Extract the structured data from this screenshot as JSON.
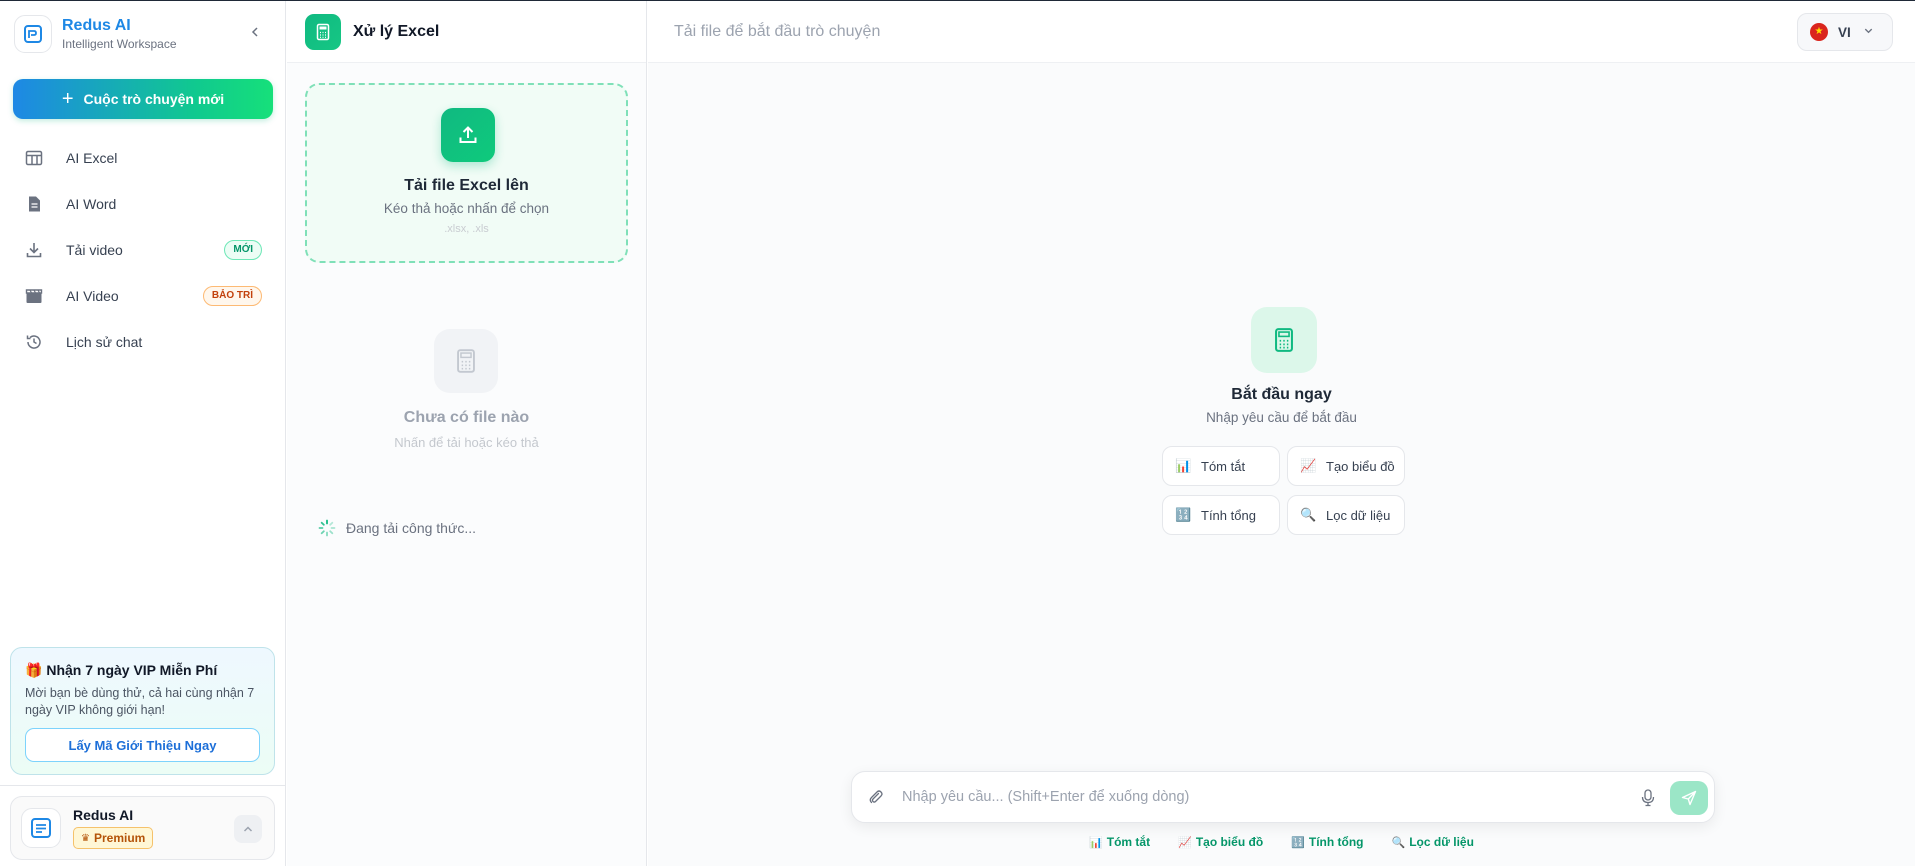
{
  "brand": {
    "name": "Redus AI",
    "subtitle": "Intelligent Workspace"
  },
  "sidebar": {
    "new_chat_label": "Cuộc trò chuyện mới",
    "items": [
      {
        "label": "AI Excel",
        "icon": "table-icon"
      },
      {
        "label": "AI Word",
        "icon": "document-icon"
      },
      {
        "label": "Tải video",
        "icon": "download-icon",
        "badge": "MỚI"
      },
      {
        "label": "AI Video",
        "icon": "clapperboard-icon",
        "badge": "BẢO TRÌ"
      },
      {
        "label": "Lịch sử chat",
        "icon": "history-icon"
      }
    ]
  },
  "vip": {
    "title": "Nhận 7 ngày VIP Miễn Phí",
    "description": "Mời bạn bè dùng thử, cả hai cùng nhận 7 ngày VIP không giới hạn!",
    "button": "Lấy Mã Giới Thiệu Ngay"
  },
  "user": {
    "name": "Redus AI",
    "plan": "Premium"
  },
  "file_panel": {
    "title": "Xử lý Excel",
    "dropzone": {
      "title": "Tải file Excel lên",
      "subtitle": "Kéo thả hoặc nhấn để chọn",
      "extensions": ".xlsx, .xls"
    },
    "empty": {
      "title": "Chưa có file nào",
      "subtitle": "Nhấn để tải hoặc kéo thả"
    },
    "loading": "Đang tải công thức..."
  },
  "main": {
    "title": "Tải file để bắt đầu trò chuyện",
    "language": "VI",
    "welcome": {
      "title": "Bắt đầu ngay",
      "subtitle": "Nhập yêu cầu để bắt đầu"
    },
    "quick_actions": [
      {
        "label": "Tóm tắt",
        "icon": "📊"
      },
      {
        "label": "Tạo biểu đồ",
        "icon": "📈"
      },
      {
        "label": "Tính tổng",
        "icon": "🔢"
      },
      {
        "label": "Lọc dữ liệu",
        "icon": "🔍"
      }
    ],
    "composer": {
      "placeholder": "Nhập yêu cầu... (Shift+Enter để xuống dòng)"
    },
    "suggestions": [
      {
        "label": "Tóm tắt",
        "icon": "📊"
      },
      {
        "label": "Tạo biểu đồ",
        "icon": "📈"
      },
      {
        "label": "Tính tổng",
        "icon": "🔢"
      },
      {
        "label": "Lọc dữ liệu",
        "icon": "🔍"
      }
    ]
  },
  "colors": {
    "accent": "#10b981",
    "brand_blue": "#1e88e5"
  }
}
